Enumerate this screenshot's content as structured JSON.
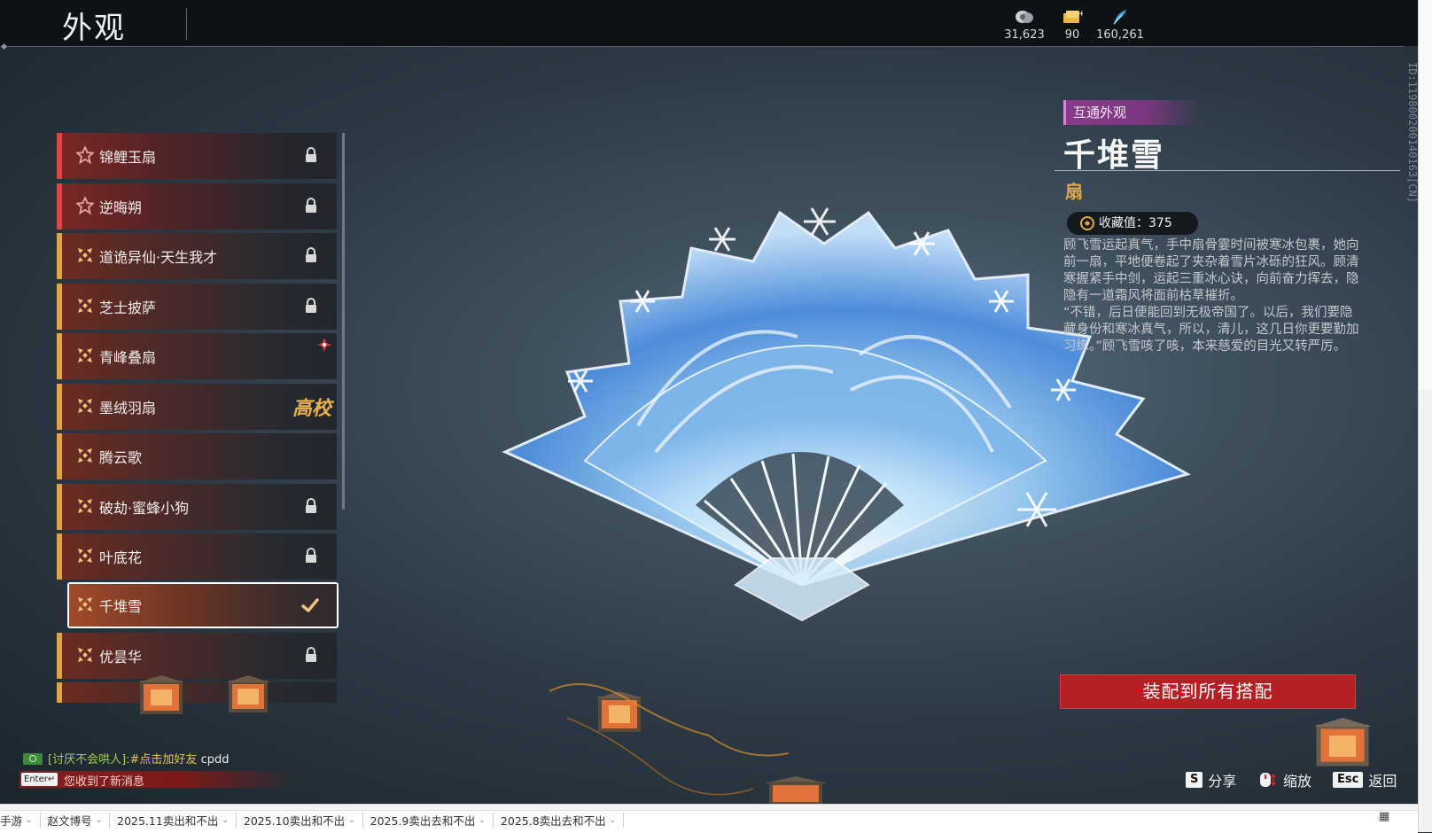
{
  "page_title": "外观",
  "currencies": [
    {
      "icon": "silver-coin-icon",
      "value": "31,623"
    },
    {
      "icon": "gold-ticket-icon",
      "value": "90"
    },
    {
      "icon": "jade-feather-icon",
      "value": "160,261"
    }
  ],
  "outfit_list": {
    "items": [
      {
        "label": "锦鲤玉扇",
        "style": "red",
        "icon": "star-icon",
        "status": "locked"
      },
      {
        "label": "逆晦朔",
        "style": "red",
        "icon": "star-icon",
        "status": "locked"
      },
      {
        "label": "道诡异仙·天生我才",
        "style": "gold",
        "icon": "cross-icon",
        "status": "locked"
      },
      {
        "label": "芝士披萨",
        "style": "gold",
        "icon": "cross-icon",
        "status": "locked"
      },
      {
        "label": "青峰叠扇",
        "style": "gold",
        "icon": "cross-icon",
        "status": "new"
      },
      {
        "label": "墨绒羽扇",
        "style": "gold",
        "icon": "cross-icon",
        "status": "badge",
        "badge": "高校"
      },
      {
        "label": "腾云歌",
        "style": "gold",
        "icon": "cross-icon",
        "status": "none"
      },
      {
        "label": "破劫·蜜蜂小狗",
        "style": "gold",
        "icon": "cross-icon",
        "status": "locked"
      },
      {
        "label": "叶底花",
        "style": "gold",
        "icon": "cross-icon",
        "status": "locked"
      },
      {
        "label": "千堆雪",
        "style": "gold",
        "icon": "cross-icon",
        "status": "selected"
      },
      {
        "label": "优昙华",
        "style": "gold",
        "icon": "cross-icon",
        "status": "locked"
      }
    ]
  },
  "detail": {
    "tag": "互通外观",
    "name": "千堆雪",
    "type": "扇",
    "collect_label": "收藏值：375",
    "description": "顾飞雪运起真气，手中扇骨霎时间被寒冰包裹，她向前一扇，平地便卷起了夹杂着雪片冰砾的狂风。顾清寒握紧手中剑，运起三重冰心诀，向前奋力挥去，隐隐有一道霜风将面前枯草摧折。\n“不错，后日便能回到无极帝国了。以后，我们要隐藏身份和寒冰真气，所以，清儿，这几日你更要勤加习练。”顾飞雪咳了咳，本来慈爱的目光又转严厉。",
    "id_text": "ID:1198002001401​63[CN]",
    "equip_button": "装配到所有搭配"
  },
  "chat": {
    "line1_channel": "[讨厌不会哄人]:",
    "line1_text": "#点击加好友",
    "line1_user": " cpdd",
    "enter_key": "Enter↵",
    "line2_text": "您收到了新消息"
  },
  "hints": [
    {
      "key": "S",
      "label": "分享"
    },
    {
      "key": "🖱",
      "label": "缩放"
    },
    {
      "key": "Esc",
      "label": "返回"
    }
  ],
  "sheet_tabs": [
    "手游",
    "赵文博号",
    "2025.11卖出和不出",
    "2025.10卖出和不出",
    "2025.9卖出去和不出",
    "2025.8卖出去和不出"
  ],
  "colors": {
    "accent_red": "#b52024",
    "gold": "#e0a24a",
    "tag_purple": "#8a3a8c"
  }
}
